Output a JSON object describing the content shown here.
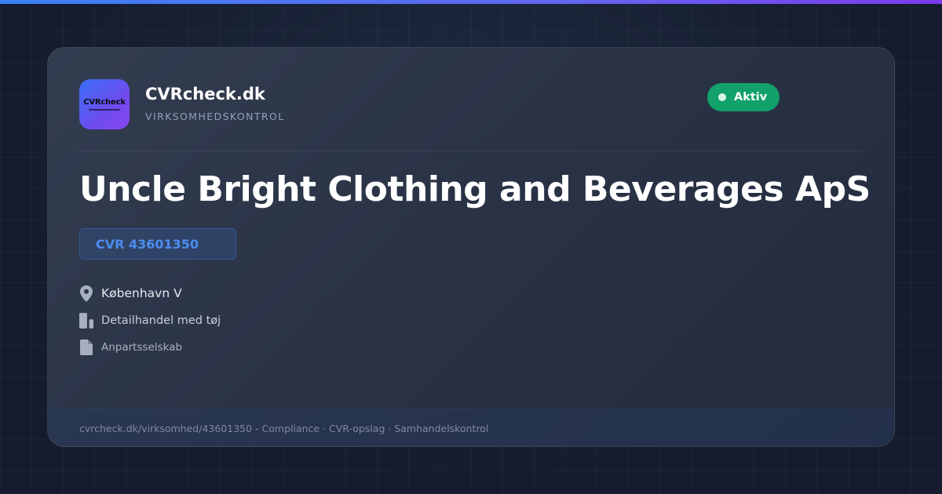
{
  "brand": {
    "logo_text": "CVRcheck",
    "name": "CVRcheck.dk",
    "tagline": "VIRKSOMHEDSKONTROL"
  },
  "status": {
    "label": "Aktiv",
    "color": "#12a06b"
  },
  "company": {
    "name": "Uncle Bright Clothing and Beverages ApS",
    "cvr": "CVR 43601350",
    "location": "København V",
    "industry": "Detailhandel med tøj",
    "company_type": "Anpartsselskab"
  },
  "icons": {
    "location": "map-pin-icon",
    "industry": "building-icon",
    "company_type": "document-icon"
  },
  "footer": {
    "text": "cvrcheck.dk/virksomhed/43601350 - Compliance · CVR-opslag · Samhandelskontrol"
  },
  "colors": {
    "accent": "#3b82f6",
    "accent_secondary": "#7c3aed",
    "background": "#141c2e"
  }
}
